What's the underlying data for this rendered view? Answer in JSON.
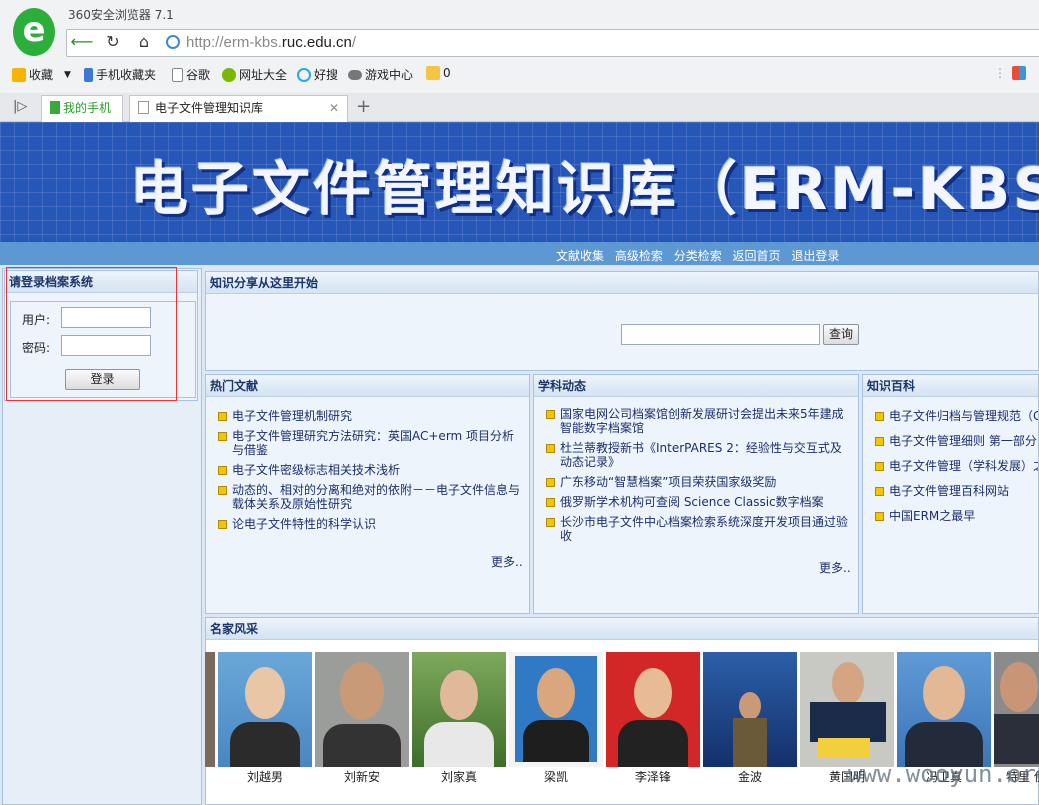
{
  "browser": {
    "app_title": "360安全浏览器 7.1",
    "url_dim": "http://erm-kbs.",
    "url_host": "ruc.edu.cn",
    "url_tail": "/",
    "bookmarks": [
      "收藏",
      "手机收藏夹",
      "谷歌",
      "网址大全",
      "好搜",
      "游戏中心",
      "0"
    ],
    "tabs": [
      {
        "label": "我的手机"
      },
      {
        "label": "电子文件管理知识库"
      }
    ],
    "colors": {
      "logo": "#2cae3b"
    }
  },
  "site": {
    "banner_title": "电子文件管理知识库（ERM-KBS",
    "menu": [
      "文献收集",
      "高级检索",
      "分类检索",
      "返回首页",
      "退出登录"
    ],
    "login": {
      "title": "请登录档案系统",
      "user_label": "用户:",
      "pwd_label": "密码:",
      "button": "登录"
    },
    "search": {
      "title": "知识分享从这里开始",
      "button": "查询",
      "value": ""
    },
    "hot": {
      "title": "热门文献",
      "items": [
        "电子文件管理机制研究",
        "电子文件管理研究方法研究：英国AC+erm 项目分析与借鉴",
        "电子文件密级标志相关技术浅析",
        "动态的、相对的分离和绝对的依附－－电子文件信息与载体关系及原始性研究",
        "论电子文件特性的科学认识"
      ],
      "more": "更多.."
    },
    "news": {
      "title": "学科动态",
      "items": [
        "国家电网公司档案馆创新发展研讨会提出未来5年建成智能数字档案馆",
        "杜兰蒂教授新书《InterPARES 2：经验性与交互式及动态记录》",
        "广东移动“智慧档案”项目荣获国家级奖励",
        "俄罗斯学术机构可查阅 Science Classic数字档案",
        "长沙市电子文件中心档案检索系统深度开发项目通过验收"
      ],
      "more": "更多.."
    },
    "wiki": {
      "title": "知识百科",
      "items": [
        "电子文件归档与管理规范（G",
        "电子文件管理细则 第一部分",
        "电子文件管理（学科发展）之",
        "电子文件管理百科网站",
        "中国ERM之最早"
      ]
    },
    "experts": {
      "title": "名家风采",
      "people": [
        "刘越男",
        "刘新安",
        "刘家真",
        "梁凯",
        "李泽锋",
        "金波",
        "黄国明",
        "冯卫真",
        "特里 伊"
      ]
    },
    "watermark": "www.wooyun.org"
  }
}
